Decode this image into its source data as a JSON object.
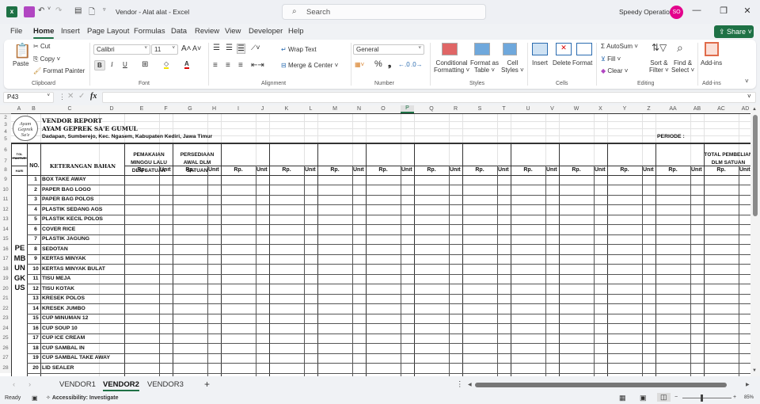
{
  "titlebar": {
    "title": "Vendor - Alat alat  -  Excel",
    "search_placeholder": "Search",
    "user_name": "Speedy Operation",
    "user_initials": "SO",
    "minimize": "—",
    "restore": "❐",
    "close": "✕"
  },
  "menu": {
    "items": [
      "File",
      "Home",
      "Insert",
      "Page Layout",
      "Formulas",
      "Data",
      "Review",
      "View",
      "Developer",
      "Help"
    ],
    "active": "Home",
    "share_label": "Share"
  },
  "ribbon": {
    "clipboard": {
      "paste": "Paste",
      "cut": "Cut",
      "copy": "Copy",
      "format_painter": "Format Painter",
      "label": "Clipboard"
    },
    "font": {
      "name": "Calibri",
      "size": "11",
      "label": "Font",
      "bold": "B",
      "italic": "I",
      "underline": "U"
    },
    "alignment": {
      "wrap_text": "Wrap Text",
      "merge_center": "Merge & Center",
      "label": "Alignment"
    },
    "number": {
      "format": "General",
      "label": "Number",
      "percent": "%",
      "comma": "❟"
    },
    "styles": {
      "conditional": "Conditional",
      "conditional2": "Formatting",
      "format_table": "Format as",
      "format_table2": "Table",
      "cell_styles": "Cell",
      "cell_styles2": "Styles",
      "label": "Styles"
    },
    "cells": {
      "insert": "Insert",
      "delete": "Delete",
      "format": "Format",
      "label": "Cells"
    },
    "editing": {
      "autosum": "AutoSum",
      "fill": "Fill",
      "clear": "Clear",
      "sort": "Sort &",
      "sort2": "Filter",
      "find": "Find &",
      "find2": "Select",
      "label": "Editing"
    },
    "addins": {
      "addins": "Add-ins",
      "label": "Add-ins"
    }
  },
  "formula_bar": {
    "name_box": "P43",
    "fx": "fx",
    "formula": ""
  },
  "columns": [
    "A",
    "B",
    "C",
    "D",
    "E",
    "F",
    "G",
    "H",
    "I",
    "J",
    "K",
    "L",
    "M",
    "N",
    "O",
    "P",
    "Q",
    "R",
    "S",
    "T",
    "U",
    "V",
    "W",
    "X",
    "Y",
    "Z",
    "AA",
    "AB",
    "AC",
    "AD"
  ],
  "selected_column": "P",
  "rows": [
    "2",
    "3",
    "4",
    "5",
    "6",
    "7",
    "8",
    "9",
    "10",
    "11",
    "12",
    "13",
    "14",
    "15",
    "16",
    "17",
    "18",
    "19",
    "20",
    "21",
    "22",
    "23",
    "24",
    "25",
    "26",
    "27",
    "28"
  ],
  "sheet": {
    "title1": "VENDOR REPORT",
    "title2": "AYAM GEPREK SA'E GUMUL",
    "address": "Dadapan, Sumberejo, Kec. Ngasem, Kabupaten Kediri, Jawa Timur",
    "periode": "PERIODE :",
    "logo_text": [
      "Ayam",
      "Geprek",
      "Sa'e"
    ],
    "hdr_tgl": "TGL FAKTUR",
    "hdr_hari": "HARI",
    "hdr_no": "NO.",
    "hdr_keterangan": "KETERANGAN BAHAN",
    "hdr_pemakaian": "PEMAKAIAN MINGGU LALU DLM SATUAN",
    "hdr_persediaan": "PERSEDIAAN AWAL DLM SATUAN",
    "hdr_total": "TOTAL PEMBELIAN DLM SATUAN",
    "rp": "Rp.",
    "unit": "Unit",
    "category": "PEMBUNGKUS",
    "items": [
      {
        "no": "1",
        "name": "BOX TAKE AWAY"
      },
      {
        "no": "2",
        "name": "PAPER BAG LOGO"
      },
      {
        "no": "3",
        "name": "PAPER BAG POLOS"
      },
      {
        "no": "4",
        "name": "PLASTIK SEDANG AGS"
      },
      {
        "no": "5",
        "name": "PLASTIK KECIL POLOS"
      },
      {
        "no": "6",
        "name": "COVER RICE"
      },
      {
        "no": "7",
        "name": "PLASTIK JAGUNG"
      },
      {
        "no": "8",
        "name": "SEDOTAN"
      },
      {
        "no": "9",
        "name": "KERTAS MINYAK"
      },
      {
        "no": "10",
        "name": "KERTAS MINYAK BULAT"
      },
      {
        "no": "11",
        "name": "TISU MEJA"
      },
      {
        "no": "12",
        "name": "TISU KOTAK"
      },
      {
        "no": "13",
        "name": "KRESEK POLOS"
      },
      {
        "no": "14",
        "name": "KRESEK JUMBO"
      },
      {
        "no": "15",
        "name": "CUP MINUMAN 12"
      },
      {
        "no": "16",
        "name": "CUP SOUP 10"
      },
      {
        "no": "17",
        "name": "CUP ICE CREAM"
      },
      {
        "no": "18",
        "name": "CUP SAMBAL IN"
      },
      {
        "no": "19",
        "name": "CUP SAMBAL TAKE AWAY"
      },
      {
        "no": "20",
        "name": "LID SEALER"
      }
    ]
  },
  "tabs": {
    "items": [
      "VENDOR1",
      "VENDOR2",
      "VENDOR3"
    ],
    "active": "VENDOR2",
    "add": "+"
  },
  "status": {
    "ready": "Ready",
    "accessibility": "Accessibility: Investigate",
    "zoom": "85%"
  },
  "colors": {
    "excel_green": "#1e7145",
    "avatar": "#e3008c"
  }
}
